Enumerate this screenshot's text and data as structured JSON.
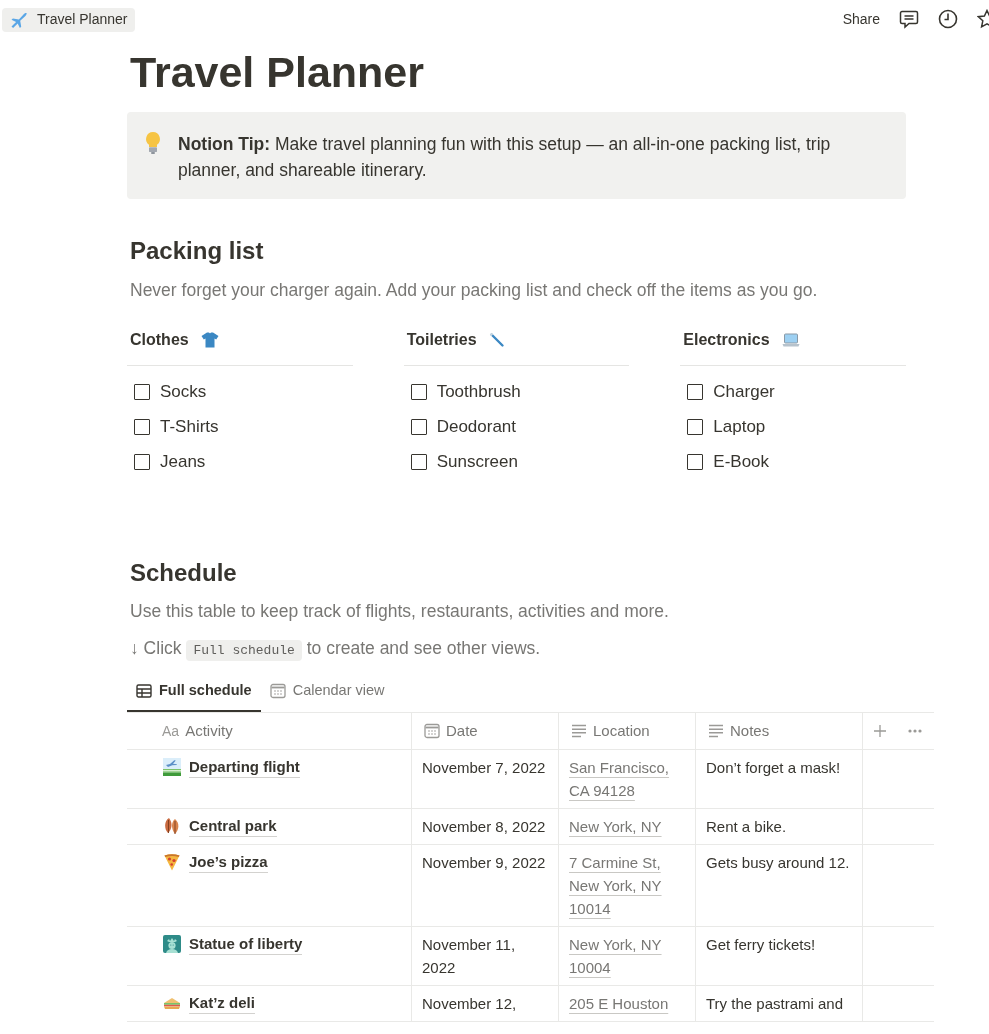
{
  "topbar": {
    "breadcrumb": "Travel Planner",
    "share": "Share"
  },
  "page": {
    "title": "Travel Planner"
  },
  "callout": {
    "text": "**Notion Tip:** Make travel planning fun with this setup — an all-in-one packing list, trip planner, and shareable itinerary."
  },
  "packing": {
    "heading": "Packing list",
    "description": "Never forget your charger again. Add your packing list and check off the items as you go.",
    "groups": [
      {
        "title": "Clothes",
        "items": [
          {
            "label": "Socks",
            "checked": false
          },
          {
            "label": "T-Shirts",
            "checked": false
          },
          {
            "label": "Jeans",
            "checked": false
          }
        ]
      },
      {
        "title": "Toiletries",
        "items": [
          {
            "label": "Toothbrush",
            "checked": false
          },
          {
            "label": "Deodorant",
            "checked": false
          },
          {
            "label": "Sunscreen",
            "checked": false
          }
        ]
      },
      {
        "title": "Electronics",
        "items": [
          {
            "label": "Charger",
            "checked": false
          },
          {
            "label": "Laptop",
            "checked": false
          },
          {
            "label": "E-Book",
            "checked": false
          }
        ]
      }
    ]
  },
  "schedule": {
    "heading": "Schedule",
    "description": "Use this table to keep track of flights, restaurants, activities and more.",
    "hint": {
      "before": "↓ Click",
      "code": "Full schedule",
      "after": "to create and see other views."
    },
    "tabs": [
      {
        "label": "Full schedule",
        "kind": "table",
        "selected": true
      },
      {
        "label": "Calendar view",
        "kind": "calendar",
        "selected": false
      }
    ],
    "table": {
      "columns": [
        {
          "label": "Activity",
          "kind": "title",
          "glyph": "Aa"
        },
        {
          "label": "Date",
          "kind": "date"
        },
        {
          "label": "Location",
          "kind": "text"
        },
        {
          "label": "Notes",
          "kind": "text"
        }
      ],
      "rows": [
        {
          "activity": "Departing flight",
          "date": "November 7, 2022",
          "location": "San Francisco, CA 94128",
          "notes": "Don’t forget a mask!"
        },
        {
          "activity": "Central park",
          "date": "November 8, 2022",
          "location": "New York, NY",
          "notes": "Rent a bike."
        },
        {
          "activity": "Joe’s pizza",
          "date": "November 9, 2022",
          "location": "7 Carmine St, New York, NY 10014",
          "notes": "Gets busy around 12."
        },
        {
          "activity": "Statue of liberty",
          "date": "November 11, 2022",
          "location": "New York, NY 10004",
          "notes": "Get ferry tickets!"
        },
        {
          "activity": "Kat’z deli",
          "date": "November 12,",
          "location": "205 E Houston",
          "notes": "Try the pastrami and"
        }
      ]
    }
  }
}
